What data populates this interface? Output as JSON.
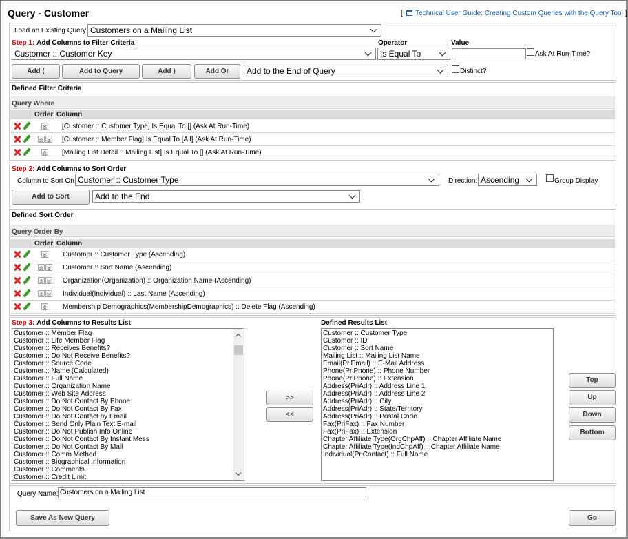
{
  "page": {
    "title": "Query - Customer",
    "guide_open": "[",
    "guide_link": "Technical User Guide: Creating Custom Queries with the Query Tool",
    "guide_close": "]"
  },
  "load_query": {
    "label": "Load an Existing Query:",
    "value": "Customers on a Mailing List"
  },
  "step1": {
    "step": "Step 1:",
    "title": "Add Columns to Filter Criteria",
    "operator_label": "Operator",
    "value_label": "Value",
    "column_value": "Customer :: Customer Key",
    "operator_value": "Is Equal To",
    "value_input": "",
    "ask_runtime_label": "Ask At Run-Time?",
    "buttons": {
      "add_open": "Add (",
      "add_to_query": "Add to Query",
      "add_close": "Add )",
      "add_or": "Add Or"
    },
    "position_value": "Add to the End of Query",
    "distinct_label": "Distinct?"
  },
  "filter": {
    "section_title": "Defined Filter Criteria",
    "sub_title": "Query Where",
    "col_order": "Order",
    "col_column": "Column",
    "rows": [
      "[Customer :: Customer Type] Is Equal To [] (Ask At Run-Time)",
      "[Customer :: Member Flag] Is Equal To [All] (Ask At Run-Time)",
      "[Mailing List Detail :: Mailing List] Is Equal To [] (Ask At Run-Time)"
    ]
  },
  "step2": {
    "step": "Step 2:",
    "title": "Add Columns to Sort Order",
    "column_label": "Column to Sort On:",
    "column_value": "Customer :: Customer Type",
    "direction_label": "Direction:",
    "direction_value": "Ascending",
    "group_label": "Group Display",
    "add_sort": "Add to Sort",
    "position_value": "Add to the End"
  },
  "sort": {
    "section_title": "Defined Sort Order",
    "sub_title": "Query Order By",
    "col_order": "Order",
    "col_column": "Column",
    "rows": [
      "Customer :: Customer Type (Ascending)",
      "Customer :: Sort Name (Ascending)",
      "Organization(Organization) :: Organization Name (Ascending)",
      "Individual(Individual) :: Last Name (Ascending)",
      "Membership Demographics(MembershipDemographics) :: Delete Flag (Ascending)"
    ]
  },
  "step3": {
    "step": "Step 3:",
    "title": "Add Columns to Results List",
    "results_title": "Defined Results List",
    "available": [
      "Customer :: Member Flag",
      "Customer :: Life Member Flag",
      "Customer :: Receives Benefits?",
      "Customer :: Do Not Receive Benefits?",
      "Customer :: Source Code",
      "Customer :: Name (Calculated)",
      "Customer :: Full Name",
      "Customer :: Organization Name",
      "Customer :: Web Site Address",
      "Customer :: Do Not Contact By Phone",
      "Customer :: Do Not Contact By Fax",
      "Customer :: Do Not Contact by Email",
      "Customer :: Send Only Plain Text E-mail",
      "Customer :: Do Not Publish Info Online",
      "Customer :: Do Not Contact By Instant Mess",
      "Customer :: Do Not Contact By Mail",
      "Customer :: Comm Method",
      "Customer :: Biographical Information",
      "Customer :: Comments",
      "Customer :: Credit Limit"
    ],
    "selected": [
      "Customer :: Customer Type",
      "Customer :: ID",
      "Customer :: Sort Name",
      "Mailing List :: Mailing List Name",
      "Email(PriEmail) :: E-Mail Address",
      "Phone(PriPhone) :: Phone Number",
      "Phone(PriPhone) :: Extension",
      "Address(PriAdr) :: Address Line 1",
      "Address(PriAdr) :: Address Line 2",
      "Address(PriAdr) :: City",
      "Address(PriAdr) :: State/Territory",
      "Address(PriAdr) :: Postal Code",
      "Fax(PriFax) :: Fax Number",
      "Fax(PriFax) :: Extension",
      "Chapter Affiliate Type(OrgChpAff) :: Chapter Affiliate Name",
      "Chapter Affiliate Type(IndChpAff) :: Chapter Affiliate Name",
      "Individual(PriContact) :: Full Name"
    ],
    "move_right": ">>",
    "move_left": "<<",
    "order_buttons": {
      "top": "Top",
      "up": "Up",
      "down": "Down",
      "bottom": "Bottom"
    }
  },
  "footer": {
    "query_name_label": "Query Name:",
    "query_name_value": "Customers on a Mailing List",
    "save_new": "Save As New Query",
    "go": "Go"
  }
}
